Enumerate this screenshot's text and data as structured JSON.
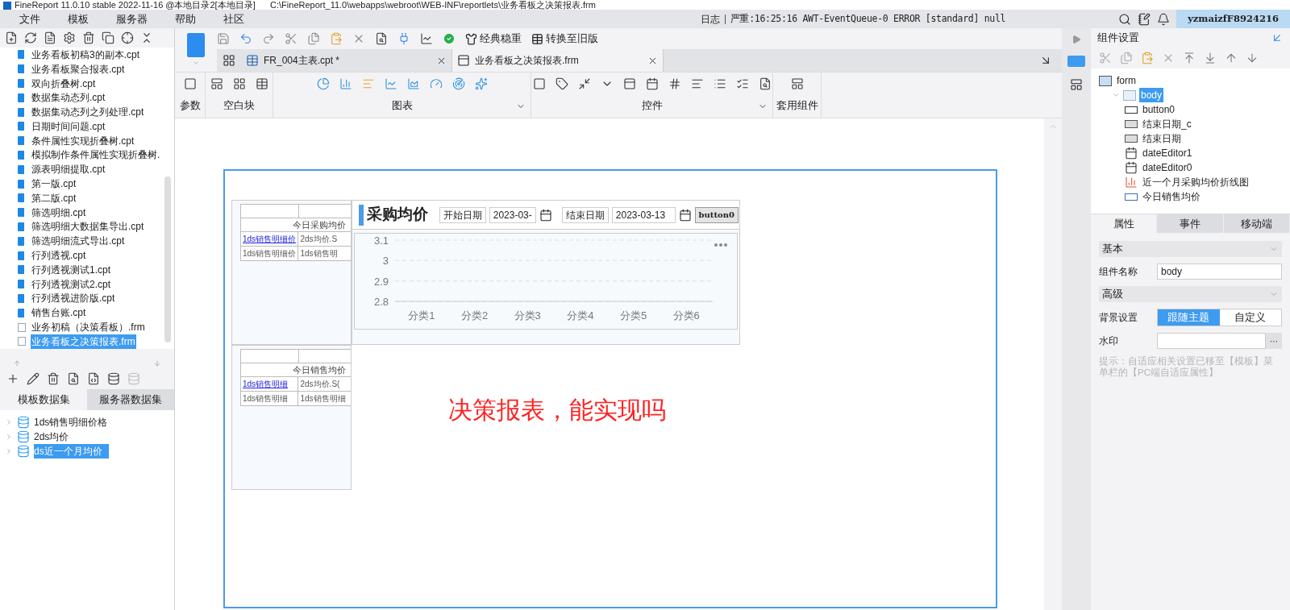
{
  "title_bar": {
    "text": "FineReport 11.0.10 stable 2022-11-16 @本地目录2[本地目录]      C:\\FineReport_11.0\\webapps\\webroot\\WEB-INF\\reportlets\\业务看板之决策报表.frm"
  },
  "menu": [
    "文件",
    "模板",
    "服务器",
    "帮助",
    "社区"
  ],
  "log": {
    "label": "日志",
    "message": "严重:16:25:16 AWT-EventQueue-0 ERROR [standard] null"
  },
  "user": "yzmaizfF8924216",
  "file_tree": [
    {
      "name": "业务看板初稿3的副本.cpt",
      "kind": "cpt",
      "selected": false
    },
    {
      "name": "业务看板聚合报表.cpt",
      "kind": "cpt",
      "selected": false
    },
    {
      "name": "双向折叠树.cpt",
      "kind": "cpt",
      "selected": false
    },
    {
      "name": "数据集动态列.cpt",
      "kind": "cpt",
      "selected": false
    },
    {
      "name": "数据集动态列之列处理.cpt",
      "kind": "cpt",
      "selected": false
    },
    {
      "name": "日期时间问题.cpt",
      "kind": "cpt",
      "selected": false
    },
    {
      "name": "条件属性实现折叠树.cpt",
      "kind": "cpt",
      "selected": false
    },
    {
      "name": "模拟制作条件属性实现折叠树.",
      "kind": "cpt",
      "selected": false
    },
    {
      "name": "源表明细提取.cpt",
      "kind": "cpt",
      "selected": false
    },
    {
      "name": "第一版.cpt",
      "kind": "cpt",
      "selected": false
    },
    {
      "name": "第二版.cpt",
      "kind": "cpt",
      "selected": false
    },
    {
      "name": "筛选明细.cpt",
      "kind": "cpt",
      "selected": false
    },
    {
      "name": "筛选明细大数据集导出.cpt",
      "kind": "cpt",
      "selected": false
    },
    {
      "name": "筛选明细流式导出.cpt",
      "kind": "cpt",
      "selected": false
    },
    {
      "name": "行列透视.cpt",
      "kind": "cpt",
      "selected": false
    },
    {
      "name": "行列透视测试1.cpt",
      "kind": "cpt",
      "selected": false
    },
    {
      "name": "行列透视测试2.cpt",
      "kind": "cpt",
      "selected": false
    },
    {
      "name": "行列透视进阶版.cpt",
      "kind": "cpt",
      "selected": false
    },
    {
      "name": "销售台账.cpt",
      "kind": "cpt",
      "selected": false
    },
    {
      "name": "业务初稿（决策看板）.frm",
      "kind": "frm",
      "selected": false
    },
    {
      "name": "业务看板之决策报表.frm",
      "kind": "frm",
      "selected": true
    }
  ],
  "dataset_tabs": [
    {
      "label": "模板数据集",
      "selected": true
    },
    {
      "label": "服务器数据集",
      "selected": false
    }
  ],
  "datasets": [
    {
      "name": "1ds销售明细价格",
      "selected": false
    },
    {
      "name": "2ds均价",
      "selected": false
    },
    {
      "name": "ds近一个月均价",
      "selected": true
    }
  ],
  "toolbar": {
    "buttons": [
      "经典稳重",
      "转换至旧版"
    ]
  },
  "tabs": [
    {
      "label": "FR_004主表.cpt *",
      "kind": "cpt",
      "selected": false
    },
    {
      "label": "业务看板之决策报表.frm",
      "kind": "frm",
      "selected": true
    }
  ],
  "ribbon_groups": [
    {
      "label": "参数",
      "kind": "param",
      "expandable": false
    },
    {
      "label": "空白块",
      "kind": "blank",
      "expandable": false
    },
    {
      "label": "图表",
      "kind": "chart",
      "expandable": true
    },
    {
      "label": "控件",
      "kind": "widget",
      "expandable": true
    },
    {
      "label": "套用组件",
      "kind": "template",
      "expandable": false
    }
  ],
  "canvas": {
    "blocks": [
      {
        "header": "今日采购均价",
        "rows": [
          [
            {
              "text": "1ds销售明细价",
              "link": true
            },
            {
              "text": "2ds均价.S",
              "link": false
            }
          ],
          [
            {
              "text": "1ds销售明细价",
              "link": false
            },
            {
              "text": "1ds销售明",
              "link": false
            }
          ]
        ]
      },
      {
        "header": "今日销售均价",
        "rows": [
          [
            {
              "text": "1ds销售明细",
              "link": true
            },
            {
              "text": "2ds均价.S(",
              "link": false
            }
          ],
          [
            {
              "text": "1ds销售明细",
              "link": false
            },
            {
              "text": "1ds销售明细",
              "link": false
            }
          ]
        ]
      }
    ],
    "widget": {
      "title": "采购均价",
      "start_label": "开始日期",
      "start_value": "2023-03-",
      "end_label": "结束日期",
      "end_value": "2023-03-13",
      "button": "button0",
      "chart_data": {
        "type": "line",
        "categories": [
          "分类1",
          "分类2",
          "分类3",
          "分类4",
          "分类5",
          "分类6"
        ],
        "ylim": [
          2.8,
          3.1
        ],
        "yticks": [
          {
            "value": 2.8,
            "label": "2.8"
          },
          {
            "value": 2.9,
            "label": "2.9"
          },
          {
            "value": 3,
            "label": "3"
          },
          {
            "value": 3.1,
            "label": "3.1"
          }
        ]
      }
    },
    "note": "决策报表，能实现吗"
  },
  "right_panel": {
    "title": "组件设置",
    "tree": [
      {
        "name": "form",
        "kind": "form",
        "selected": false,
        "children": [
          {
            "name": "body",
            "kind": "body",
            "selected": true,
            "children": [
              {
                "name": "button0",
                "kind": "button",
                "selected": false
              },
              {
                "name": "结束日期_c",
                "kind": "label",
                "selected": false
              },
              {
                "name": "结束日期",
                "kind": "label",
                "selected": false
              },
              {
                "name": "dateEditor1",
                "kind": "date",
                "selected": false
              },
              {
                "name": "dateEditor0",
                "kind": "date",
                "selected": false
              },
              {
                "name": "近一个月采购均价折线图",
                "kind": "chart",
                "selected": false
              },
              {
                "name": "今日销售均价",
                "kind": "report",
                "selected": false
              }
            ]
          }
        ]
      }
    ],
    "prop_tabs": [
      {
        "label": "属性",
        "selected": true
      },
      {
        "label": "事件",
        "selected": false
      },
      {
        "label": "移动端",
        "selected": false
      }
    ],
    "basic_section": "基本",
    "name_field": {
      "label": "组件名称",
      "value": "body"
    },
    "advanced_section": "高级",
    "background": {
      "label": "背景设置",
      "options": [
        {
          "label": "跟随主题",
          "selected": true
        },
        {
          "label": "自定义",
          "selected": false
        }
      ]
    },
    "watermark": {
      "label": "水印",
      "button": "···"
    },
    "hint": "提示：自适应相关设置已移至【模板】菜单栏的【PC端自适应属性】"
  }
}
